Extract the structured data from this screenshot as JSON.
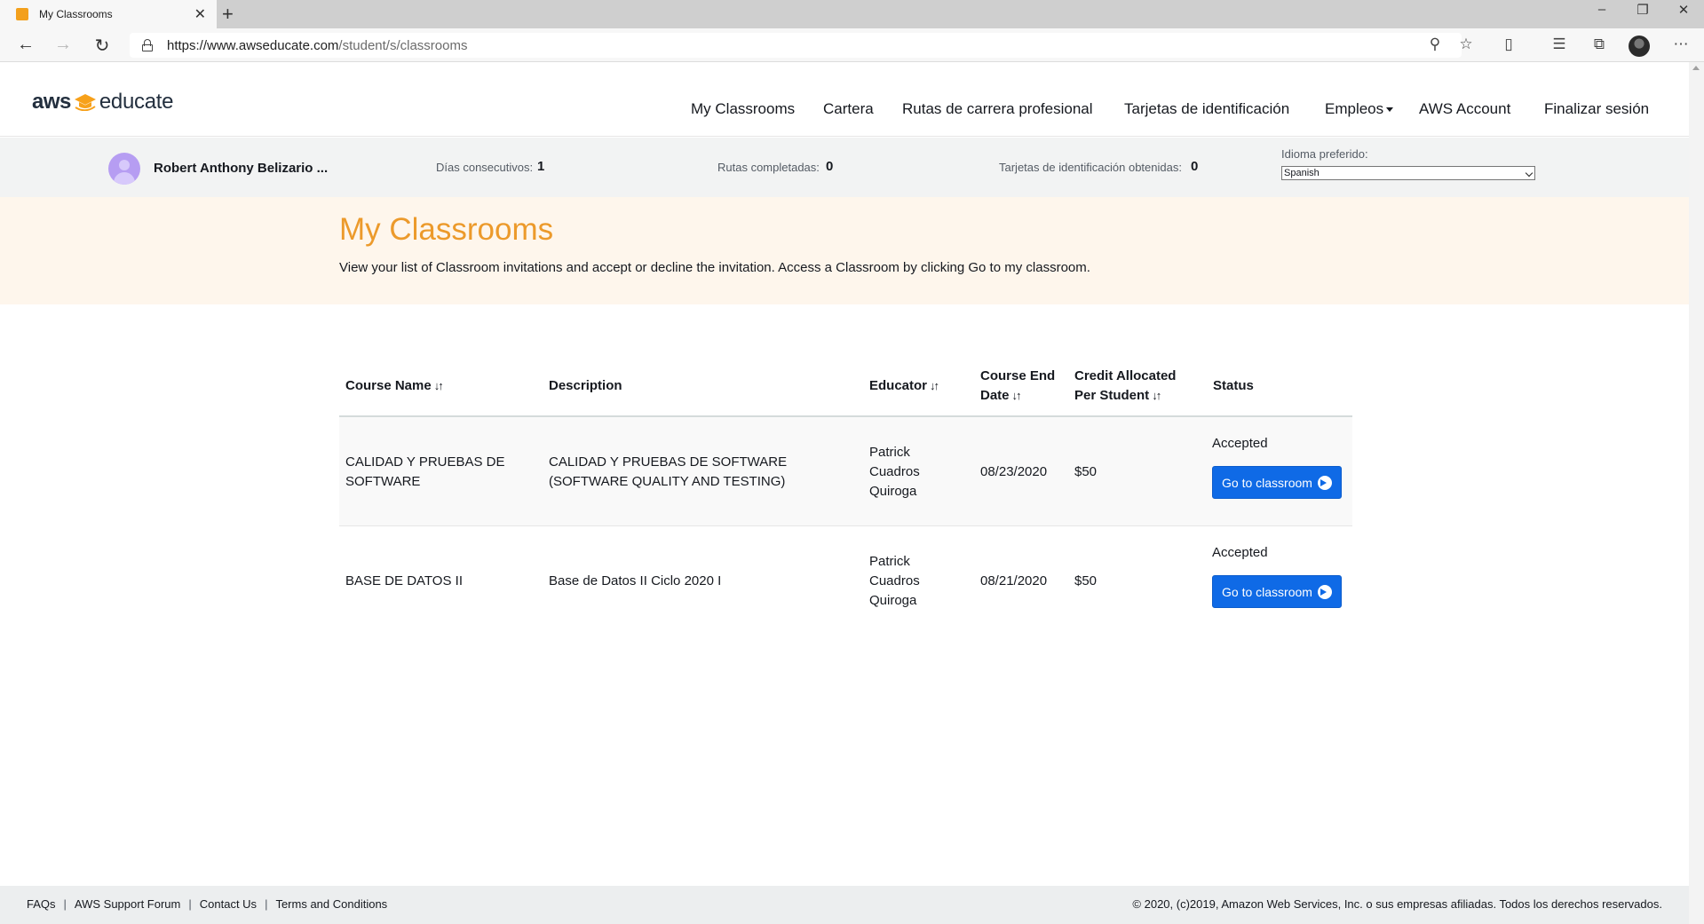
{
  "browser": {
    "tab_title": "My Classrooms",
    "url_domain": "https://www.awseducate.com",
    "url_path": "/student/s/classrooms",
    "icons": [
      "back-arrow-icon",
      "forward-arrow-icon",
      "refresh-icon",
      "lock-icon",
      "key-icon",
      "star-icon",
      "reading-view-icon",
      "favorites-icon",
      "collections-icon",
      "profile-avatar",
      "more-icon"
    ]
  },
  "brand": {
    "logo_left": "aws",
    "logo_right": "educate",
    "accent_color": "#ec9a2b"
  },
  "nav": {
    "items": [
      "My Classrooms",
      "Cartera",
      "Rutas de carrera profesional",
      "Tarjetas de identificación",
      "Empleos",
      "AWS Account",
      "Finalizar sesión"
    ]
  },
  "profile": {
    "name": "Robert Anthony Belizario ...",
    "streak_label": "Días consecutivos:",
    "streak_value": "1",
    "paths_label": "Rutas completadas:",
    "paths_value": "0",
    "badges_label": "Tarjetas de identificación obtenidas:",
    "badges_value": "0",
    "language_label": "Idioma preferido:",
    "language_value": "Spanish"
  },
  "hero": {
    "title": "My Classrooms",
    "description": "View your list of Classroom invitations and accept or decline the invitation. Access a Classroom by clicking Go to my classroom."
  },
  "table": {
    "headers": {
      "course_name": "Course Name",
      "description": "Description",
      "educator": "Educator",
      "end_date_1": "Course End",
      "end_date_2": "Date",
      "credit_1": "Credit Allocated",
      "credit_2": "Per Student",
      "status": "Status"
    },
    "rows": [
      {
        "course_1": "CALIDAD Y PRUEBAS DE",
        "course_2": "SOFTWARE",
        "desc_1": "CALIDAD Y PRUEBAS DE SOFTWARE",
        "desc_2": "(SOFTWARE QUALITY AND TESTING)",
        "educator_1": "Patrick",
        "educator_2": "Cuadros",
        "educator_3": "Quiroga",
        "end_date": "08/23/2020",
        "credit": "$50",
        "status": "Accepted",
        "button": "Go to classroom"
      },
      {
        "course_1": "BASE DE DATOS II",
        "course_2": "",
        "desc_1": "Base de Datos II Ciclo 2020 I",
        "desc_2": "",
        "educator_1": "Patrick",
        "educator_2": "Cuadros",
        "educator_3": "Quiroga",
        "end_date": "08/21/2020",
        "credit": "$50",
        "status": "Accepted",
        "button": "Go to classroom"
      }
    ]
  },
  "footer": {
    "links": [
      "FAQs",
      "AWS Support Forum",
      "Contact Us",
      "Terms and Conditions"
    ],
    "copyright": "© 2020, (c)2019, Amazon Web Services, Inc. o sus empresas afiliadas. Todos los derechos reservados."
  }
}
